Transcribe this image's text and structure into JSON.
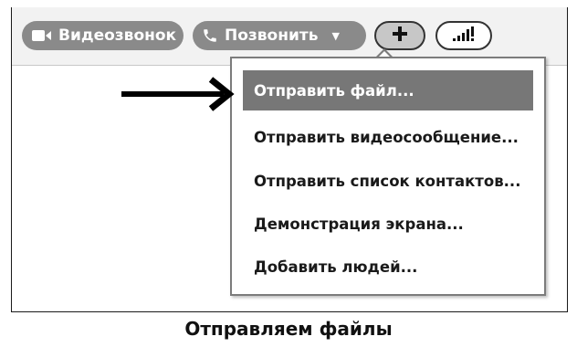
{
  "toolbar": {
    "video_call_label": "Видеозвонок",
    "video_call_icon": "video-camera-icon",
    "call_label": "Позвонить",
    "call_icon": "phone-icon",
    "call_dropdown_icon": "caret-down-icon",
    "plus_icon": "plus-icon",
    "signal_icon": "signal-quality-icon"
  },
  "menu": {
    "items": [
      {
        "label": "Отправить файл...",
        "selected": true
      },
      {
        "label": "Отправить видеосообщение...",
        "selected": false
      },
      {
        "label": "Отправить список контактов...",
        "selected": false
      },
      {
        "label": "Демонстрация экрана...",
        "selected": false
      },
      {
        "label": "Добавить людей...",
        "selected": false
      }
    ]
  },
  "caption": "Отправляем файлы",
  "colors": {
    "pill_bg": "#8a8a8a",
    "selected_item_bg": "#777777",
    "menu_border": "#7c7c7c"
  }
}
